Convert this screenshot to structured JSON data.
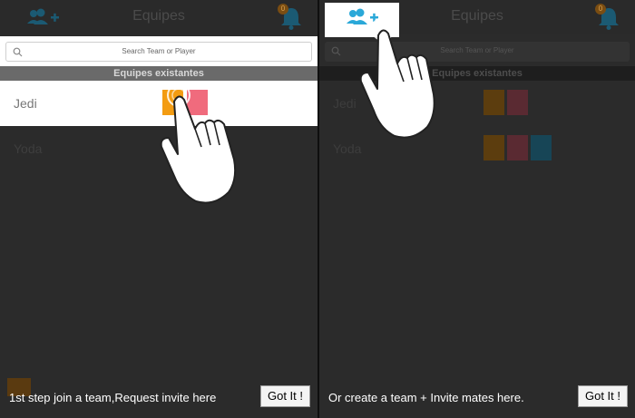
{
  "screen_title": "Equipes",
  "notification_badge": "0",
  "search_placeholder": "Search Team or Player",
  "section_header": "Equipes existantes",
  "teams": [
    {
      "name": "Jedi",
      "member_colors": [
        "#f39c12",
        "#f06b7d"
      ]
    },
    {
      "name": "Yoda",
      "member_colors": [
        "#f39c12",
        "#f06b7d",
        "#2aa8d8"
      ]
    }
  ],
  "left_panel": {
    "tip": "1st step join a team,Request invite here",
    "got_it_label": "Got It !"
  },
  "right_panel": {
    "tip": "Or create a team + Invite mates here.",
    "got_it_label": "Got It !"
  },
  "colors": {
    "accent_blue": "#2aa8d8",
    "orange": "#f39c12",
    "pink": "#f06b7d",
    "overlay_bg": "#2b2b2b"
  },
  "icons": [
    "add-team-icon",
    "bell-icon",
    "search-icon",
    "hand-pointer-icon"
  ]
}
